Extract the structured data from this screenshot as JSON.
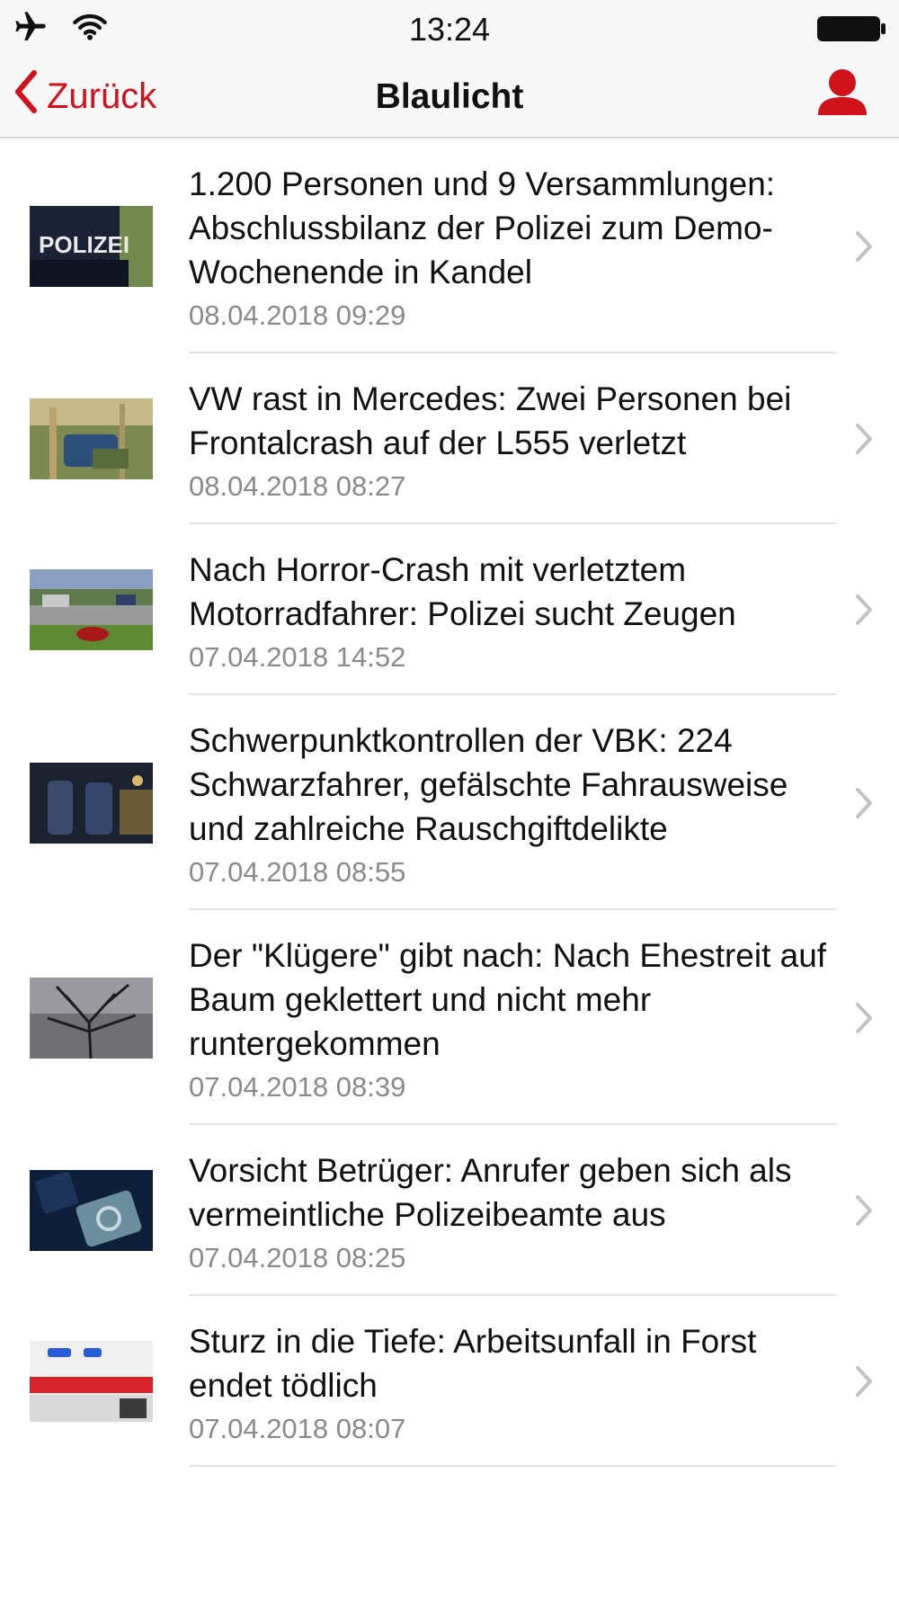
{
  "status_bar": {
    "time": "13:24",
    "icons": [
      "airplane-icon",
      "wifi-icon",
      "battery-icon"
    ]
  },
  "nav": {
    "back_label": "Zurück",
    "title": "Blaulicht",
    "profile_icon": "user-icon"
  },
  "colors": {
    "accent": "#d0121b",
    "secondary_text": "#8a8a8a",
    "separator": "#e3e3e3"
  },
  "articles": [
    {
      "headline": "1.200 Personen und 9 Versammlungen: Abschlussbilanz der Polizei zum Demo-Wochenende in Kandel",
      "date": "08.04.2018 09:29",
      "thumb": "POLIZEI"
    },
    {
      "headline": "VW rast in Mercedes: Zwei Personen bei Frontalcrash auf der L555 verletzt",
      "date": "08.04.2018 08:27"
    },
    {
      "headline": "Nach Horror-Crash mit verletztem Motorradfahrer: Polizei sucht Zeugen",
      "date": "07.04.2018 14:52"
    },
    {
      "headline": "Schwerpunktkontrollen der VBK: 224 Schwarzfahrer, gefälschte Fahrausweise und zahlreiche Rauschgiftdelikte",
      "date": "07.04.2018 08:55"
    },
    {
      "headline": "Der \"Klügere\" gibt nach: Nach Ehestreit auf Baum geklettert und nicht mehr runtergekommen",
      "date": "07.04.2018 08:39"
    },
    {
      "headline": "Vorsicht Betrüger: Anrufer geben sich als vermeintliche Polizeibeamte aus",
      "date": "07.04.2018 08:25"
    },
    {
      "headline": "Sturz in die Tiefe: Arbeitsunfall in Forst endet tödlich",
      "date": "07.04.2018 08:07"
    }
  ]
}
